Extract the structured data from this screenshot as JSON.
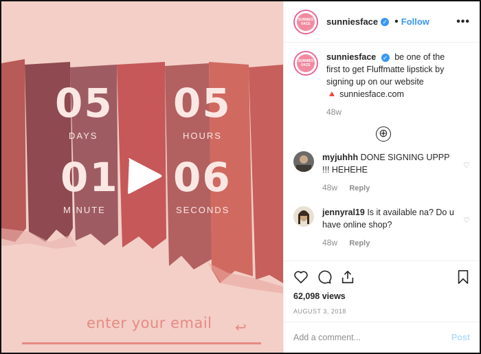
{
  "media": {
    "countdown": {
      "days_value": "05",
      "days_label": "DAYS",
      "hours_value": "05",
      "hours_label": "HOURS",
      "minutes_value": "01",
      "minutes_label": "MINUTE",
      "seconds_value": "06",
      "seconds_label": "SECONDS"
    },
    "email_placeholder": "enter your email",
    "email_arrow": "↩"
  },
  "header": {
    "username": "sunniesface",
    "separator": "•",
    "follow_label": "Follow",
    "more_label": "•••",
    "avatar_text": "SUNNIES FACE"
  },
  "caption": {
    "username": "sunniesface",
    "text": "be one of the first to get Fluffmatte lipstick by signing up on our website",
    "link_emoji": "🔺",
    "link": "sunniesface.com",
    "time": "48w"
  },
  "load_more_icon": "⊕",
  "comments": [
    {
      "username": "myjuhhh",
      "text": "DONE SIGNING UPPP !!! HEHEHE",
      "time": "48w",
      "reply": "Reply"
    },
    {
      "username": "jennyral19",
      "text": "Is it available na? Do u have online shop?",
      "time": "48w",
      "reply": "Reply"
    }
  ],
  "stats": {
    "views": "62,098 views",
    "date": "AUGUST 3, 2018"
  },
  "add_comment": {
    "placeholder": "Add a comment...",
    "post_label": "Post"
  },
  "colors": {
    "accent_blue": "#3897f0",
    "email_pink": "#e58a83",
    "background_pink": "#f3cfc7"
  },
  "icons": [
    "heart-icon",
    "comment-icon",
    "share-icon",
    "bookmark-icon",
    "play-icon",
    "verified-badge-icon",
    "plus-circle-icon"
  ]
}
